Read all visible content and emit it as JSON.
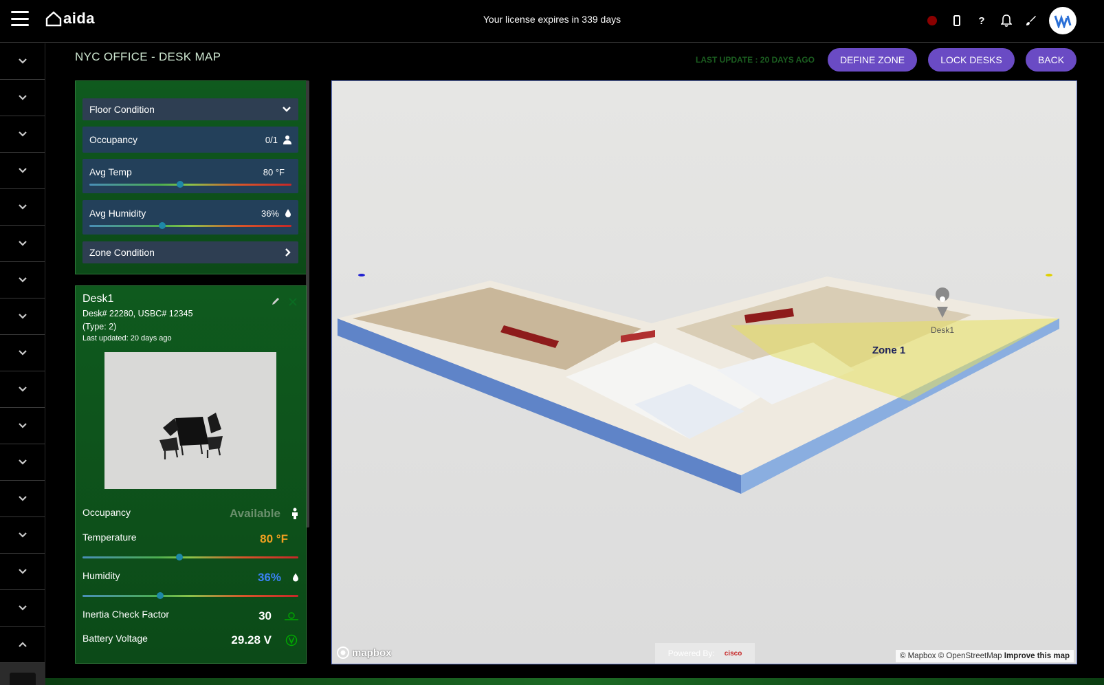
{
  "app": {
    "logo_text": "aida",
    "license_text": "Your license expires in 339 days"
  },
  "header": {
    "icons": [
      "status-dot-icon",
      "mobile-icon",
      "help-icon",
      "bell-icon",
      "brush-icon",
      "avatar"
    ],
    "status_color": "#8b0000"
  },
  "page": {
    "title": "NYC OFFICE - DESK MAP",
    "last_update": "LAST UPDATE : 20 DAYS AGO",
    "buttons": {
      "define_zone": "DEFINE ZONE",
      "lock_desks": "LOCK DESKS",
      "back": "BACK"
    },
    "accent": "#6a4bc4"
  },
  "floor_panel": {
    "floor_condition": "Floor Condition",
    "occupancy_label": "Occupancy",
    "occupancy_value": "0/1",
    "avg_temp_label": "Avg Temp",
    "avg_temp_value": "80 °F",
    "avg_temp_level": 0.45,
    "avg_humidity_label": "Avg Humidity",
    "avg_humidity_value": "36%",
    "avg_humidity_level": 0.36,
    "zone_condition": "Zone Condition"
  },
  "desk_panel": {
    "name": "Desk1",
    "ids": "Desk# 22280, USBC# 12345",
    "type": "(Type: 2)",
    "last_updated": "Last updated: 20 days ago",
    "occupancy_label": "Occupancy",
    "occupancy_value": "Available",
    "temperature_label": "Temperature",
    "temperature_value": "80 °F",
    "temperature_level": 0.45,
    "humidity_label": "Humidity",
    "humidity_value": "36%",
    "humidity_level": 0.36,
    "inertia_label": "Inertia Check Factor",
    "inertia_value": "30",
    "battery_label": "Battery Voltage",
    "battery_value": "29.28 V",
    "colors": {
      "available": "#6a8f6c",
      "temperature": "#f0a020",
      "humidity": "#3b82f6"
    }
  },
  "map": {
    "zone_label": "Zone 1",
    "pin_label": "Desk1",
    "mapbox_logo": "mapbox",
    "powered_by": "Powered By:",
    "powered_brand": "cisco",
    "attribution": "© Mapbox © OpenStreetMap",
    "improve": "Improve this map"
  }
}
